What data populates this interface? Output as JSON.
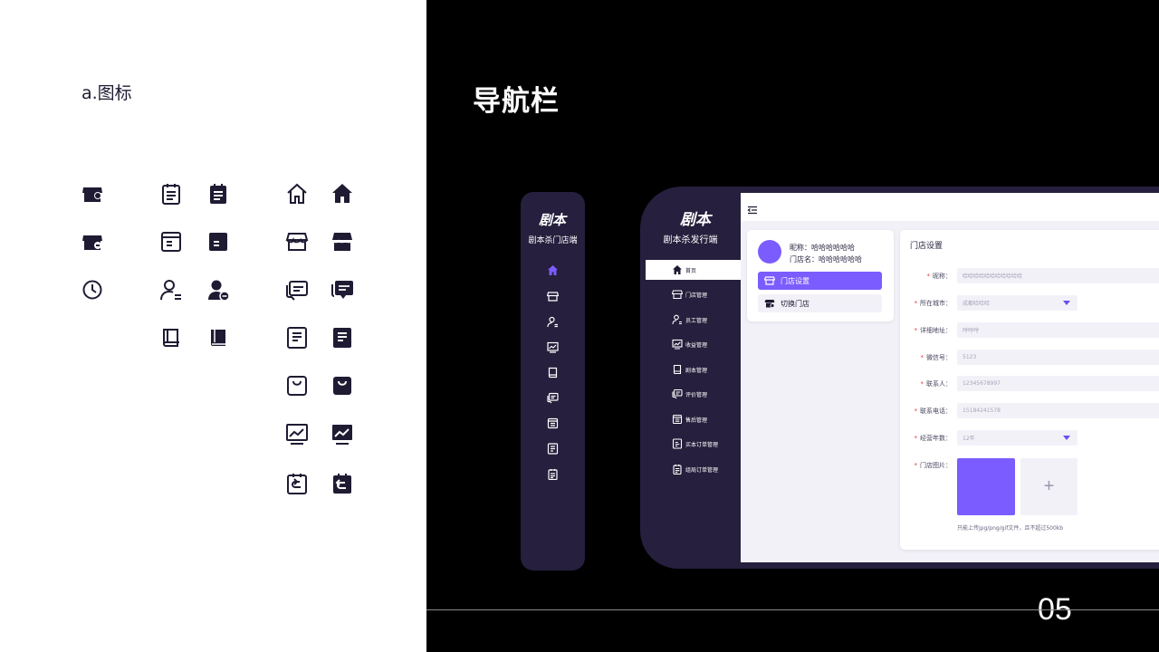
{
  "left_panel": {
    "section_label": "a.图标"
  },
  "heading": "导航栏",
  "page_number": "05",
  "brand": {
    "logo_text": "剧本",
    "mini_title": "剧本杀门店端",
    "sidebar_title": "剧本杀发行端"
  },
  "icon_grid": [
    "store-icon",
    "store-badge-icon",
    "clock-icon",
    "clipboard-outline-icon",
    "clipboard-filled-icon",
    "document-outline-icon",
    "document-filled-icon",
    "user-outline-icon",
    "user-filled-icon",
    "book-outline-icon",
    "book-filled-icon",
    "home-outline-icon",
    "home-filled-icon",
    "shop-outline-icon",
    "shop-filled-icon",
    "chat-outline-icon",
    "chat-filled-icon",
    "list-outline-icon",
    "list-filled-icon",
    "bag-outline-icon",
    "bag-filled-icon",
    "chart-outline-icon",
    "chart-filled-icon",
    "return-outline-icon",
    "return-filled-icon"
  ],
  "mini_nav_icons": [
    "home-icon",
    "store-icon",
    "user-icon",
    "chart-icon",
    "book-icon",
    "chat-icon",
    "list-icon",
    "document-icon",
    "clipboard-icon"
  ],
  "nav": {
    "items": [
      {
        "label": "首页",
        "icon": "home-icon"
      },
      {
        "label": "门店管理",
        "icon": "store-icon"
      },
      {
        "label": "员工管理",
        "icon": "user-icon"
      },
      {
        "label": "收益管理",
        "icon": "chart-icon"
      },
      {
        "label": "剧本管理",
        "icon": "book-icon"
      },
      {
        "label": "评价管理",
        "icon": "chat-icon"
      },
      {
        "label": "售后管理",
        "icon": "list-icon"
      },
      {
        "label": "买本订单管理",
        "icon": "document-icon"
      },
      {
        "label": "组局订单管理",
        "icon": "clipboard-icon"
      }
    ],
    "active_index": 0
  },
  "user_card": {
    "nickname_label": "昵称：",
    "nickname_value": "哈哈哈哈哈哈",
    "store_label": "门店名：",
    "store_value": "哈哈哈哈哈哈",
    "primary_button": "门店设置",
    "secondary_button": "切换门店"
  },
  "form": {
    "title": "门店设置",
    "fields": [
      {
        "label": "昵称：",
        "value": "哈哈哈哈哈哈哈哈哈哈哈"
      },
      {
        "label": "所在城市：",
        "value": "成都哈哈哈"
      },
      {
        "label": "详细地址：",
        "value": "哼哼哼"
      },
      {
        "label": "微信号：",
        "value": "5123"
      },
      {
        "label": "联系人：",
        "value": "12345678997"
      },
      {
        "label": "联系电话：",
        "value": "15184241578"
      },
      {
        "label": "经营年数：",
        "value": "12年"
      },
      {
        "label": "门店图片：",
        "value": ""
      }
    ],
    "upload_add": "+",
    "upload_hint": "只能上传jpg/png/gif文件，且不超过500kb"
  },
  "colors": {
    "accent": "#7b5cff",
    "sidebar": "#261f3d",
    "required": "#e23c3c"
  }
}
